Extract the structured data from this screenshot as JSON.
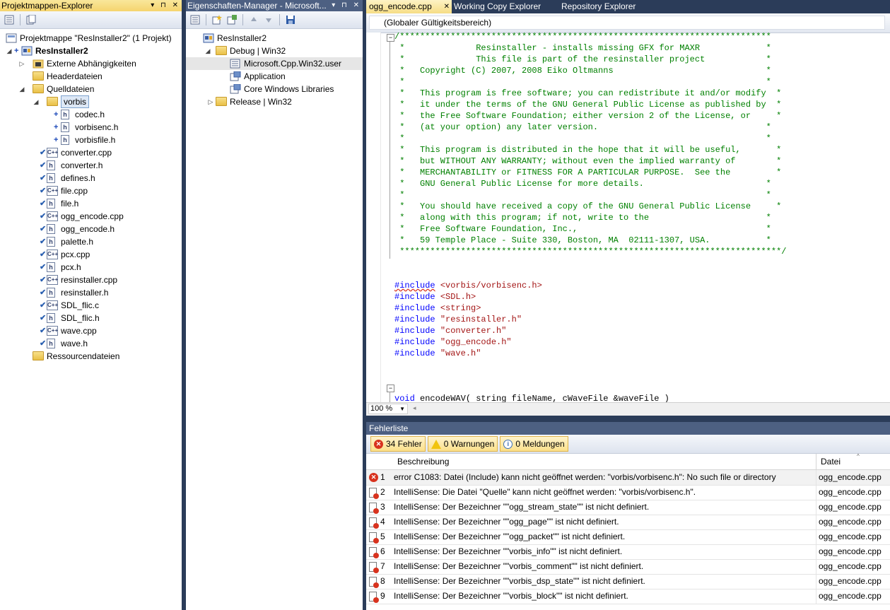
{
  "solution_explorer": {
    "title": "Projektmappen-Explorer",
    "title_buttons": "▾ ⊓ ✕",
    "items": [
      {
        "label": "Projektmappe \"ResInstaller2\" (1 Projekt)",
        "bold": false
      },
      {
        "label": "ResInstaller2",
        "bold": true
      },
      {
        "label": "Externe Abhängigkeiten"
      },
      {
        "label": "Headerdateien"
      },
      {
        "label": "Quelldateien"
      },
      {
        "label": "vorbis"
      },
      {
        "label": "codec.h"
      },
      {
        "label": "vorbisenc.h"
      },
      {
        "label": "vorbisfile.h"
      },
      {
        "label": "converter.cpp"
      },
      {
        "label": "converter.h"
      },
      {
        "label": "defines.h"
      },
      {
        "label": "file.cpp"
      },
      {
        "label": "file.h"
      },
      {
        "label": "ogg_encode.cpp"
      },
      {
        "label": "ogg_encode.h"
      },
      {
        "label": "palette.h"
      },
      {
        "label": "pcx.cpp"
      },
      {
        "label": "pcx.h"
      },
      {
        "label": "resinstaller.cpp"
      },
      {
        "label": "resinstaller.h"
      },
      {
        "label": "SDL_flic.c"
      },
      {
        "label": "SDL_flic.h"
      },
      {
        "label": "wave.cpp"
      },
      {
        "label": "wave.h"
      },
      {
        "label": "Ressourcendateien"
      }
    ]
  },
  "property_manager": {
    "title": "Eigenschaften-Manager - Microsoft...",
    "title_buttons": "▾ ⊓ ✕",
    "items": [
      {
        "label": "ResInstaller2"
      },
      {
        "label": "Debug | Win32"
      },
      {
        "label": "Microsoft.Cpp.Win32.user"
      },
      {
        "label": "Application"
      },
      {
        "label": "Core Windows Libraries"
      },
      {
        "label": "Release | Win32"
      }
    ]
  },
  "editor": {
    "tabs": [
      {
        "label": "ogg_encode.cpp",
        "active": true
      },
      {
        "label": "Working Copy Explorer",
        "active": false
      },
      {
        "label": "Repository Explorer",
        "active": false
      }
    ],
    "tab_close": "✕",
    "scope": "(Globaler Gültigkeitsbereich)",
    "zoom": "100 %",
    "comment_lines": [
      "/*************************************************************************",
      " *              Resinstaller - installs missing GFX for MAXR             *",
      " *              This file is part of the resinstaller project            *",
      " *   Copyright (C) 2007, 2008 Eiko Oltmanns                              *",
      " *                                                                       *",
      " *   This program is free software; you can redistribute it and/or modify  *",
      " *   it under the terms of the GNU General Public License as published by  *",
      " *   the Free Software Foundation; either version 2 of the License, or     *",
      " *   (at your option) any later version.                                 *",
      " *                                                                       *",
      " *   This program is distributed in the hope that it will be useful,       *",
      " *   but WITHOUT ANY WARRANTY; without even the implied warranty of        *",
      " *   MERCHANTABILITY or FITNESS FOR A PARTICULAR PURPOSE.  See the         *",
      " *   GNU General Public License for more details.                        *",
      " *                                                                       *",
      " *   You should have received a copy of the GNU General Public License     *",
      " *   along with this program; if not, write to the                       *",
      " *   Free Software Foundation, Inc.,                                     *",
      " *   59 Temple Place - Suite 330, Boston, MA  02111-1307, USA.           *",
      " ***************************************************************************/"
    ],
    "includes": [
      {
        "kw": "#include",
        "file": "<vorbis/vorbisenc.h>"
      },
      {
        "kw": "#include",
        "file": "<SDL.h>"
      },
      {
        "kw": "#include",
        "file": "<string>"
      },
      {
        "kw": "#include",
        "file": "\"resinstaller.h\""
      },
      {
        "kw": "#include",
        "file": "\"converter.h\""
      },
      {
        "kw": "#include",
        "file": "\"ogg_encode.h\""
      },
      {
        "kw": "#include",
        "file": "\"wave.h\""
      }
    ],
    "func_kw": "void",
    "func_rest": " encodeWAV( string fileName, cWaveFile &waveFile )",
    "brace": "{"
  },
  "error_list": {
    "title": "Fehlerliste",
    "filters": {
      "errors": "34 Fehler",
      "warnings": "0 Warnungen",
      "messages": "0 Meldungen"
    },
    "columns": {
      "description": "Beschreibung",
      "file": "Datei"
    },
    "rows": [
      {
        "n": "1",
        "type": "error",
        "desc": "error C1083: Datei (Include) kann nicht geöffnet werden: \"vorbis/vorbisenc.h\": No such file or directory",
        "file": "ogg_encode.cpp"
      },
      {
        "n": "2",
        "type": "intellisense",
        "desc": "IntelliSense: Die Datei \"Quelle\" kann nicht geöffnet werden: \"vorbis/vorbisenc.h\".",
        "file": "ogg_encode.cpp"
      },
      {
        "n": "3",
        "type": "intellisense",
        "desc": "IntelliSense: Der Bezeichner \"\"ogg_stream_state\"\" ist nicht definiert.",
        "file": "ogg_encode.cpp"
      },
      {
        "n": "4",
        "type": "intellisense",
        "desc": "IntelliSense: Der Bezeichner \"\"ogg_page\"\" ist nicht definiert.",
        "file": "ogg_encode.cpp"
      },
      {
        "n": "5",
        "type": "intellisense",
        "desc": "IntelliSense: Der Bezeichner \"\"ogg_packet\"\" ist nicht definiert.",
        "file": "ogg_encode.cpp"
      },
      {
        "n": "6",
        "type": "intellisense",
        "desc": "IntelliSense: Der Bezeichner \"\"vorbis_info\"\" ist nicht definiert.",
        "file": "ogg_encode.cpp"
      },
      {
        "n": "7",
        "type": "intellisense",
        "desc": "IntelliSense: Der Bezeichner \"\"vorbis_comment\"\" ist nicht definiert.",
        "file": "ogg_encode.cpp"
      },
      {
        "n": "8",
        "type": "intellisense",
        "desc": "IntelliSense: Der Bezeichner \"\"vorbis_dsp_state\"\" ist nicht definiert.",
        "file": "ogg_encode.cpp"
      },
      {
        "n": "9",
        "type": "intellisense",
        "desc": "IntelliSense: Der Bezeichner \"\"vorbis_block\"\" ist nicht definiert.",
        "file": "ogg_encode.cpp"
      }
    ]
  }
}
